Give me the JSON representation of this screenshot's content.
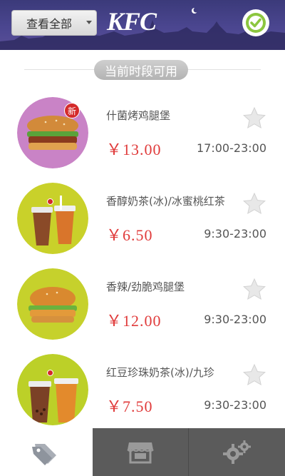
{
  "header": {
    "filter_label": "查看全部",
    "logo_text": "KFC"
  },
  "section": {
    "title": "当前时段可用"
  },
  "items": [
    {
      "name": "什菌烤鸡腿堡",
      "price": "￥13.00",
      "time": "17:00-23:00",
      "badge": "新",
      "bg": "#c983c6"
    },
    {
      "name": "香醇奶茶(冰)/冰蜜桃红茶",
      "price": "￥6.50",
      "time": "9:30-23:00",
      "badge": "",
      "bg": "#c9d12a"
    },
    {
      "name": "香辣/劲脆鸡腿堡",
      "price": "￥12.00",
      "time": "9:30-23:00",
      "badge": "",
      "bg": "#c6d12c"
    },
    {
      "name": "红豆珍珠奶茶(冰)/九珍",
      "price": "￥7.50",
      "time": "9:30-23:00",
      "badge": "",
      "bg": "#bcd028"
    }
  ],
  "colors": {
    "header_bg": "#4b4690",
    "price_red": "#e03b3b",
    "tabbar_bg": "#5b5b5b"
  },
  "tabs": [
    {
      "icon": "tag-icon",
      "active": true
    },
    {
      "icon": "store-icon",
      "active": false
    },
    {
      "icon": "gear-icon",
      "active": false
    }
  ]
}
